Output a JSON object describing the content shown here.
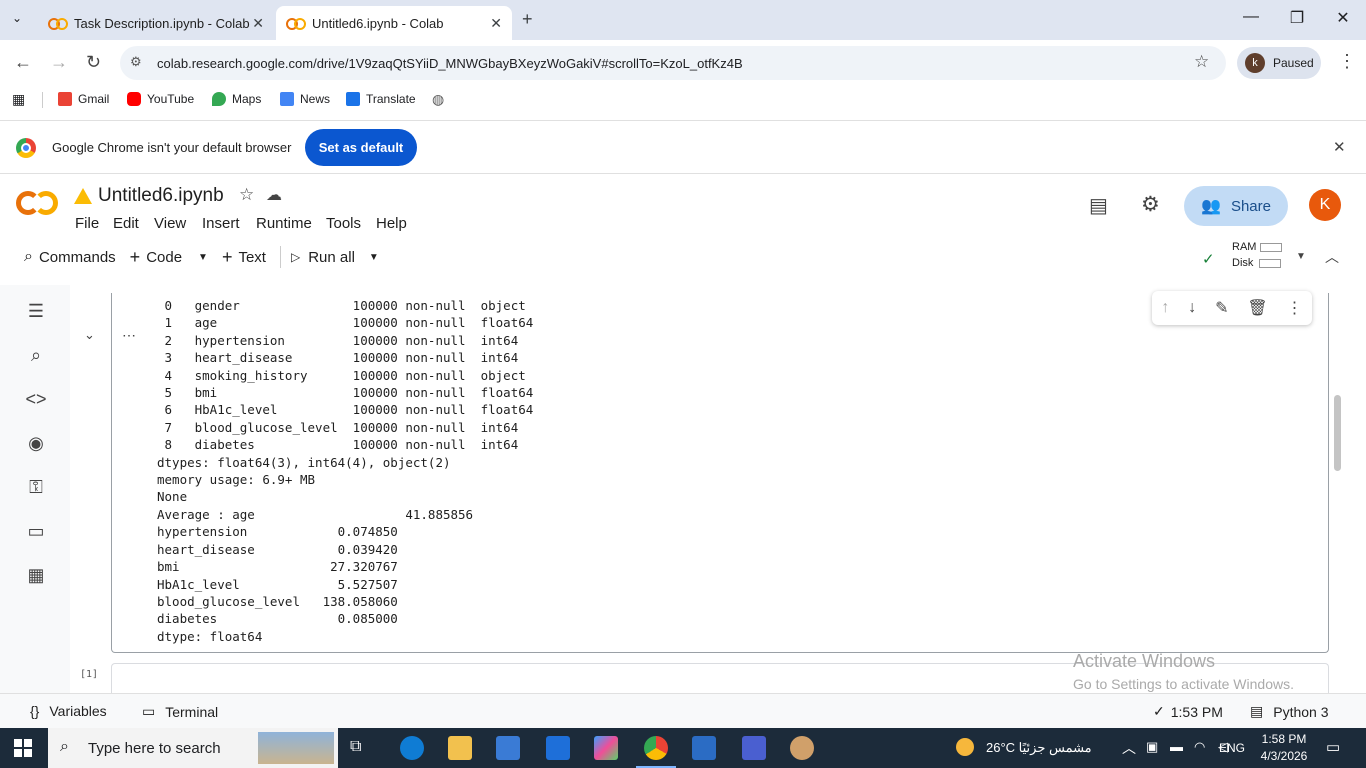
{
  "browser": {
    "tabs": [
      {
        "title": "Task Description.ipynb - Colab",
        "active": false
      },
      {
        "title": "Untitled6.ipynb - Colab",
        "active": true
      }
    ],
    "new_tab": "+",
    "url": "colab.research.google.com/drive/1V9zaqQtSYiiD_MNWGbayBXeyzWoGakiV#scrollTo=KzoL_otfKz4B",
    "profile_initial": "k",
    "profile_status": "Paused",
    "bookmarks": [
      "Gmail",
      "YouTube",
      "Maps",
      "News",
      "Translate"
    ]
  },
  "infobar": {
    "message": "Google Chrome isn't your default browser",
    "button": "Set as default"
  },
  "colab": {
    "notebook_title": "Untitled6.ipynb",
    "menu": [
      "File",
      "Edit",
      "View",
      "Insert",
      "Runtime",
      "Tools",
      "Help"
    ],
    "share_label": "Share",
    "avatar_initial": "K",
    "commands": {
      "search": "Commands",
      "code": "Code",
      "text": "Text",
      "run_all": "Run all"
    },
    "resources": {
      "ram": "RAM",
      "disk": "Disk"
    }
  },
  "output_lines": [
    " 0   gender               100000 non-null  object",
    " 1   age                  100000 non-null  float64",
    " 2   hypertension         100000 non-null  int64",
    " 3   heart_disease        100000 non-null  int64",
    " 4   smoking_history      100000 non-null  object",
    " 5   bmi                  100000 non-null  float64",
    " 6   HbA1c_level          100000 non-null  float64",
    " 7   blood_glucose_level  100000 non-null  int64",
    " 8   diabetes             100000 non-null  int64",
    "dtypes: float64(3), int64(4), object(2)",
    "memory usage: 6.9+ MB",
    "None",
    "Average : age                    41.885856",
    "hypertension            0.074850",
    "heart_disease           0.039420",
    "bmi                    27.320767",
    "HbA1c_level             5.527507",
    "blood_glucose_level   138.058060",
    "diabetes                0.085000",
    "dtype: float64"
  ],
  "next_cell_label": "[1]",
  "watermark": {
    "line1": "Activate Windows",
    "line2": "Go to Settings to activate Windows."
  },
  "statusbar": {
    "variables": "Variables",
    "terminal": "Terminal",
    "time": "1:53 PM",
    "runtime": "Python 3"
  },
  "taskbar": {
    "search_placeholder": "Type here to search",
    "weather": "26°C  مشمس جزئيًا",
    "language": "ENG",
    "clock_time": "1:58 PM",
    "clock_date": "4/3/2026"
  }
}
